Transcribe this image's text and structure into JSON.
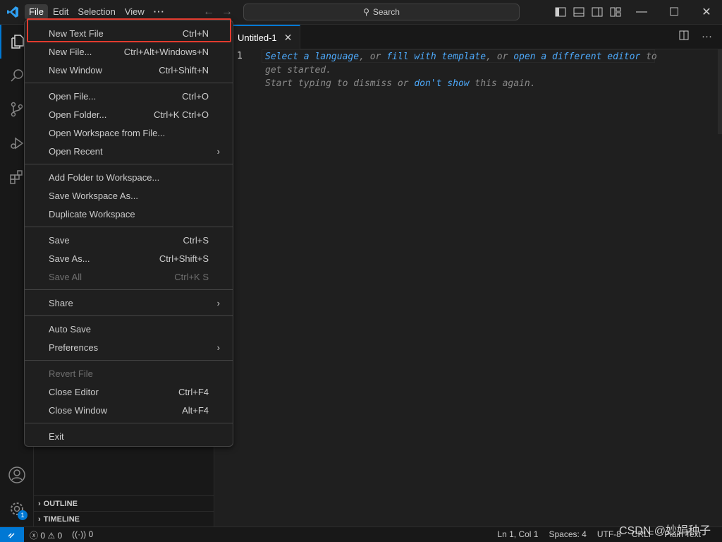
{
  "menubar": [
    "File",
    "Edit",
    "Selection",
    "View",
    "···"
  ],
  "search": {
    "label": "Search"
  },
  "window_controls": {
    "minimize": "—",
    "maximize": "☐",
    "close": "✕"
  },
  "tab": {
    "title": "Untitled-1",
    "close": "✕"
  },
  "editor": {
    "line_number": "1",
    "hint_line1": {
      "select_language": "Select a language",
      "sep1": ", or ",
      "fill_template": "fill with template",
      "sep2": ", or ",
      "open_editor": "open a different editor",
      "end": " to"
    },
    "hint_line2": "get started.",
    "hint_line3": {
      "start": "Start typing to dismiss or ",
      "dont_show": "don't show",
      "end": " this again."
    }
  },
  "sidebar": {
    "outline": "OUTLINE",
    "timeline": "TIMELINE"
  },
  "activity": {
    "settings_badge": "1"
  },
  "file_menu": {
    "new_text_file": {
      "label": "New Text File",
      "kb": "Ctrl+N"
    },
    "new_file": {
      "label": "New File...",
      "kb": "Ctrl+Alt+Windows+N"
    },
    "new_window": {
      "label": "New Window",
      "kb": "Ctrl+Shift+N"
    },
    "open_file": {
      "label": "Open File...",
      "kb": "Ctrl+O"
    },
    "open_folder": {
      "label": "Open Folder...",
      "kb": "Ctrl+K Ctrl+O"
    },
    "open_workspace": {
      "label": "Open Workspace from File..."
    },
    "open_recent": {
      "label": "Open Recent"
    },
    "add_folder": {
      "label": "Add Folder to Workspace..."
    },
    "save_workspace_as": {
      "label": "Save Workspace As..."
    },
    "duplicate_workspace": {
      "label": "Duplicate Workspace"
    },
    "save": {
      "label": "Save",
      "kb": "Ctrl+S"
    },
    "save_as": {
      "label": "Save As...",
      "kb": "Ctrl+Shift+S"
    },
    "save_all": {
      "label": "Save All",
      "kb": "Ctrl+K S"
    },
    "share": {
      "label": "Share"
    },
    "auto_save": {
      "label": "Auto Save"
    },
    "preferences": {
      "label": "Preferences"
    },
    "revert_file": {
      "label": "Revert File"
    },
    "close_editor": {
      "label": "Close Editor",
      "kb": "Ctrl+F4"
    },
    "close_window": {
      "label": "Close Window",
      "kb": "Alt+F4"
    },
    "exit": {
      "label": "Exit"
    }
  },
  "statusbar": {
    "errors": "0",
    "warnings": "0",
    "ports": "0",
    "position": "Ln 1, Col 1",
    "spaces": "Spaces: 4",
    "encoding": "UTF-8",
    "eol": "CRLF",
    "language": "Plain Text"
  },
  "watermark": "CSDN @妙娟种子",
  "colors": {
    "accent": "#0078d4",
    "highlight_box": "#e23b2e",
    "link": "#4daafc"
  }
}
